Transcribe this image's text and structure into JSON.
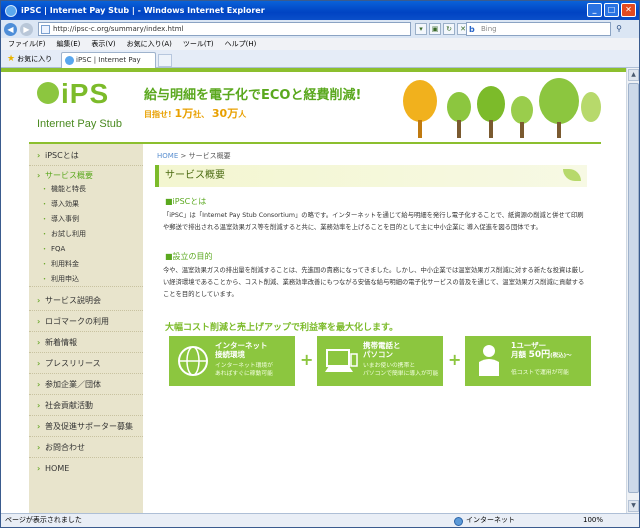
{
  "window": {
    "title": "iPSC | Internet Pay Stub | - Windows Internet Explorer"
  },
  "address": {
    "url": "http://ipsc-c.org/summary/index.html",
    "search_placeholder": "Bing"
  },
  "menu": [
    "ファイル(F)",
    "編集(E)",
    "表示(V)",
    "お気に入り(A)",
    "ツール(T)",
    "ヘルプ(H)"
  ],
  "favorites": {
    "label": "お気に入り",
    "tab_title": "iPSC | Internet Pay Stub |"
  },
  "status": {
    "text": "ページが表示されました",
    "zone": "インターネット",
    "zoom": "100%"
  },
  "header": {
    "logo": "iPS",
    "logo_sub": "Internet Pay Stub",
    "slogan": "給与明細を電子化でECOと経費削減!",
    "target_prefix": "目指せ!",
    "target_a": "1万",
    "target_a_unit": "社、",
    "target_b": "30万",
    "target_b_unit": "人"
  },
  "sidebar": {
    "items": [
      {
        "label": "iPSCとは"
      },
      {
        "label": "サービス概要"
      },
      {
        "label": "サービス説明会"
      },
      {
        "label": "ロゴマークの利用"
      },
      {
        "label": "新着情報"
      },
      {
        "label": "プレスリリース"
      },
      {
        "label": "参加企業／団体"
      },
      {
        "label": "社会貢献活動"
      },
      {
        "label": "普及促進サポーター募集"
      },
      {
        "label": "お問合わせ"
      },
      {
        "label": "HOME"
      }
    ],
    "subitems": [
      "機能と特長",
      "導入効果",
      "導入事例",
      "お試し利用",
      "FQA",
      "利用料金",
      "利用申込"
    ]
  },
  "breadcrumb": {
    "home": "HOME",
    "sep": ">",
    "current": "サービス概要"
  },
  "section_title": "サービス概要",
  "about": {
    "heading": "■iPSCとは",
    "text": "「iPSC」は「Internet Pay Stub Consortium」の略です。インターネットを通じて給与明細を発行し電子化することで、紙資源の削減と併せて印刷や郵送で排出される温室効果ガス等を削減すると共に、業務効率を上げることを目的として主に中小企業に 導入促進を図る団体です。"
  },
  "purpose": {
    "heading": "■設立の目的",
    "text": "今や、温室効果ガスの排出量を削減することは、先進国の責務になってきました。しかし、中小企業では温室効果ガス削減に対する新たな投資は厳しい経済環境であることから、コスト削減、業務効率改善にもつながる安価な給与明細の電子化サービスの普及を通じて、温室効果ガス削減に貢献することを目的としています。"
  },
  "tagline": "大幅コスト削減と売上げアップで利益率を最大化します。",
  "boxes": [
    {
      "title1": "インターネット",
      "title2": "接続環境",
      "desc1": "インターネット環境が",
      "desc2": "あればすぐに稼動可能"
    },
    {
      "title1": "携帯電話と",
      "title2": "パソコン",
      "desc1": "いまお使いの携帯と",
      "desc2": "パソコンで簡単に導入が可能"
    },
    {
      "title1": "1ユーザー",
      "title2": "月額",
      "price": "50円",
      "price_note": "(税込)～",
      "desc1": "低コストで運用が可能"
    }
  ],
  "plus": "+"
}
